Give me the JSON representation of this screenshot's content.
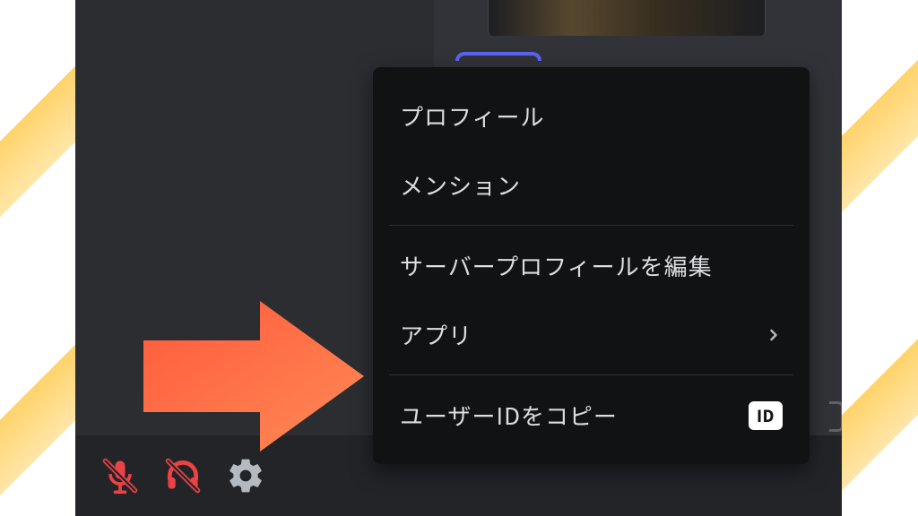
{
  "menu": {
    "profile": "プロフィール",
    "mention": "メンション",
    "editServerProfile": "サーバープロフィールを編集",
    "apps": "アプリ",
    "copyUserId": "ユーザーIDをコピー",
    "idBadge": "ID"
  },
  "colors": {
    "muteRed": "#ed4245",
    "gear": "#b5bac1",
    "arrowStart": "#ff5a3c",
    "arrowEnd": "#ff8a55"
  }
}
